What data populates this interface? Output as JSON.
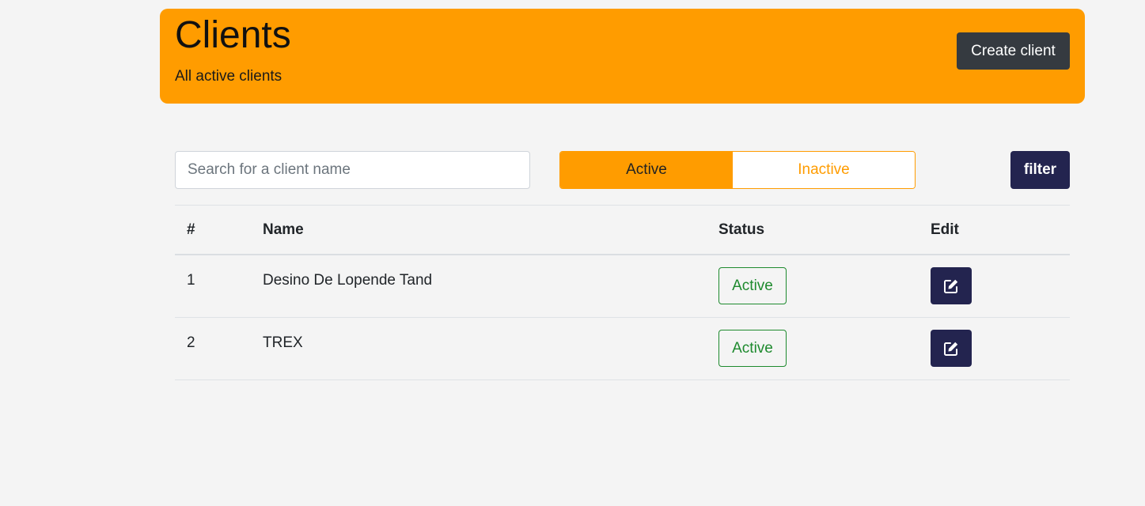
{
  "header": {
    "title": "Clients",
    "subtitle": "All active clients",
    "create_label": "Create client",
    "background_color": "#ff9c00"
  },
  "filters": {
    "search_placeholder": "Search for a client name",
    "search_value": "",
    "active_label": "Active",
    "inactive_label": "Inactive",
    "selected": "Active",
    "filter_label": "filter"
  },
  "table": {
    "columns": [
      "#",
      "Name",
      "Status",
      "Edit"
    ],
    "rows": [
      {
        "num": "1",
        "name": "Desino De Lopende Tand",
        "status": "Active",
        "edit_icon": "edit-icon"
      },
      {
        "num": "2",
        "name": "TREX",
        "status": "Active",
        "edit_icon": "edit-icon"
      }
    ]
  },
  "colors": {
    "accent": "#ff9c00",
    "primary_dark": "#23244f",
    "status_active": "#1e8a2e",
    "create_button": "#353a40"
  }
}
